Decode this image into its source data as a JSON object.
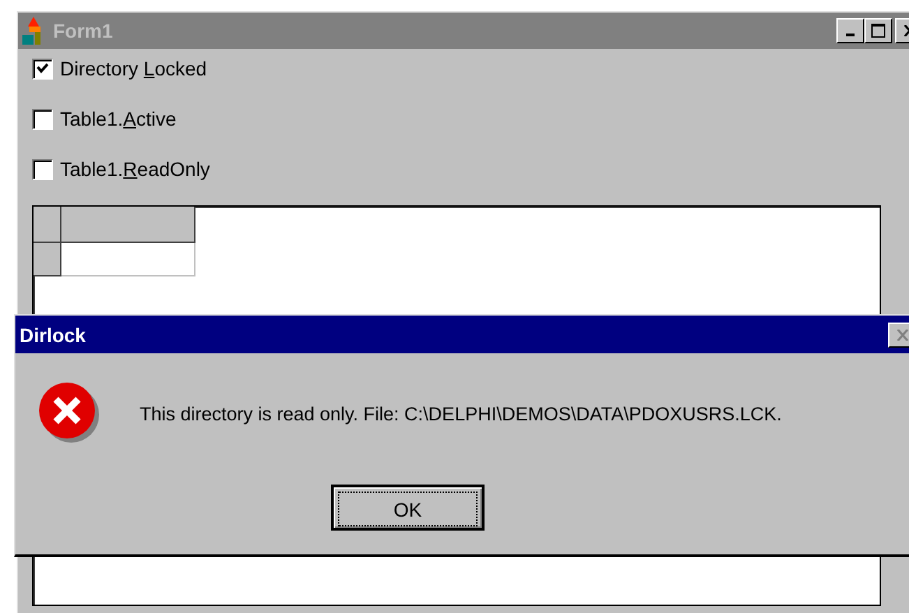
{
  "window": {
    "title": "Form1",
    "active": false
  },
  "checkboxes": [
    {
      "label_parts": [
        "Directory ",
        "L",
        "ocked"
      ],
      "checked": true
    },
    {
      "label_parts": [
        "Table1.",
        "A",
        "ctive"
      ],
      "checked": false
    },
    {
      "label_parts": [
        "Table1.",
        "R",
        "eadOnly"
      ],
      "checked": false
    }
  ],
  "dialog": {
    "title": "Dirlock",
    "kind": "error",
    "message": "This directory is read only. File: C:\\DELPHI\\DEMOS\\DATA\\PDOXUSRS.LCK.",
    "buttons": [
      {
        "label": "OK",
        "focused": true
      }
    ]
  }
}
